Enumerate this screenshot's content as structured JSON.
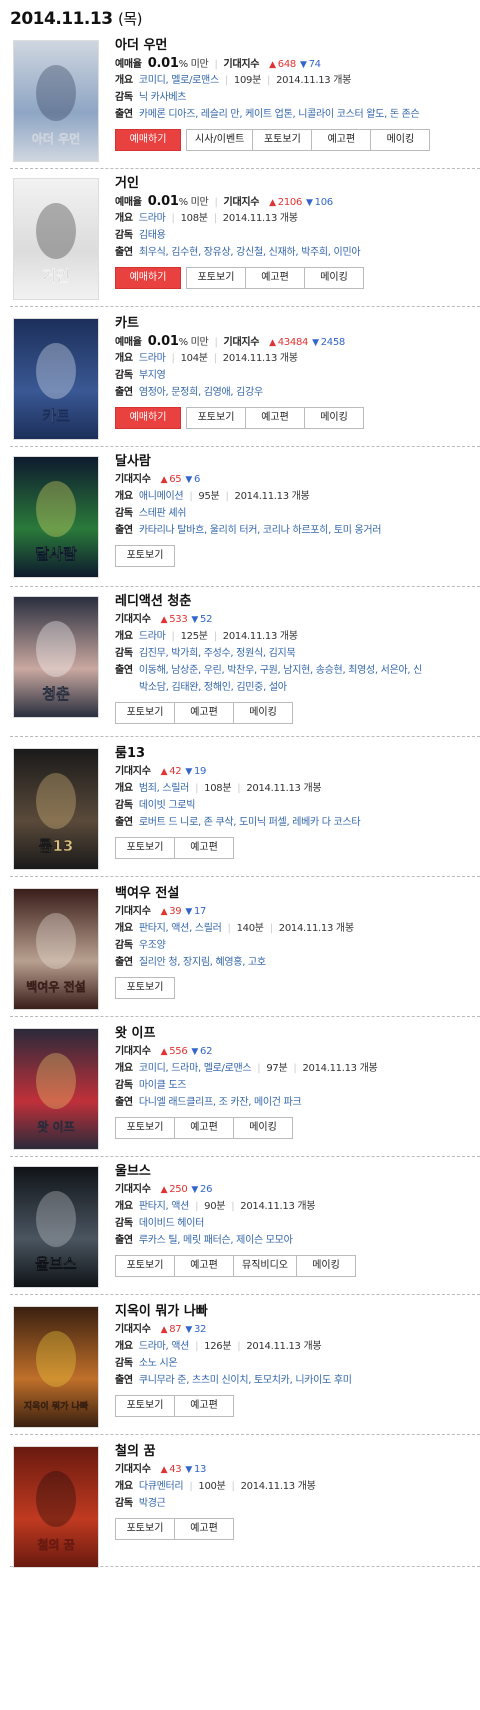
{
  "header": {
    "date": "2014.11.13",
    "dow": "(목)"
  },
  "labels": {
    "sales": "예매율",
    "expect": "기대지수",
    "overview": "개요",
    "director": "감독",
    "cast": "출연"
  },
  "movies": [
    {
      "title": "아더 우먼",
      "sales": "0.01",
      "sales_unit": "% 미만",
      "up": "648",
      "down": "74",
      "genre": "코미디, 멜로/로맨스",
      "runtime": "109분",
      "release": "2014.11.13 개봉",
      "director": "닉 카사베츠",
      "cast": "카메론 디아즈, 레슬리 만, 케이트 업톤, 니콜라이 코스터 왈도, 돈 존슨",
      "buttons": [
        "예매하기",
        "시사/이벤트",
        "포토보기",
        "예고편",
        "메이킹"
      ],
      "poster_text": "아더 우먼",
      "colors": [
        "#cfd6e0",
        "#8ea5c4",
        "#2b3a55"
      ]
    },
    {
      "title": "거인",
      "sales": "0.01",
      "sales_unit": "% 미만",
      "up": "2106",
      "down": "106",
      "genre": "드라마",
      "runtime": "108분",
      "release": "2014.11.13 개봉",
      "director": "김태용",
      "cast": "최우식, 김수현, 장유상, 강신철, 신재하, 박주희, 이민아",
      "buttons": [
        "예매하기",
        "포토보기",
        "예고편",
        "메이킹"
      ],
      "poster_text": "거인",
      "colors": [
        "#f2f2f2",
        "#dcdcdc",
        "#333333"
      ]
    },
    {
      "title": "카트",
      "sales": "0.01",
      "sales_unit": "% 미만",
      "up": "43484",
      "down": "2458",
      "genre": "드라마",
      "runtime": "104분",
      "release": "2014.11.13 개봉",
      "director": "부지영",
      "cast": "염정아, 문정희, 김영애, 김강우",
      "buttons": [
        "예매하기",
        "포토보기",
        "예고편",
        "메이킹"
      ],
      "poster_text": "카트",
      "colors": [
        "#1c2f5a",
        "#3a5894",
        "#e9eef6"
      ]
    },
    {
      "title": "달사람",
      "up": "65",
      "down": "6",
      "genre": "애니메이션",
      "runtime": "95분",
      "release": "2014.11.13 개봉",
      "director": "스테판 셰쉬",
      "cast": "카타리나 탈바흐, 울리히 터커, 코리나 하르포히, 토미 옹거러",
      "buttons": [
        "포토보기"
      ],
      "poster_text": "달사람",
      "colors": [
        "#0e1a2e",
        "#2a7a3a",
        "#e8e36a"
      ]
    },
    {
      "title": "레디액션 청춘",
      "up": "533",
      "down": "52",
      "genre": "드라마",
      "runtime": "125분",
      "release": "2014.11.13 개봉",
      "director": "김진무, 박가희, 주성수, 정원식, 김지묵",
      "cast": "이동해, 남상준, 우린, 박찬우, 구원, 남지현, 송승현, 최영성, 서은아, 신",
      "cast2": "박소담, 김태완, 정해인, 김민중, 설아",
      "buttons": [
        "포토보기",
        "예고편",
        "메이킹"
      ],
      "poster_text": "청춘",
      "colors": [
        "#2a2f3f",
        "#c9a8a0",
        "#ffffff"
      ]
    },
    {
      "title": "룸13",
      "up": "42",
      "down": "19",
      "genre": "범죄, 스릴러",
      "runtime": "108분",
      "release": "2014.11.13 개봉",
      "director": "데이빗 그로빅",
      "cast": "로버트 드 니로, 존 쿠삭, 도미닉 퍼셀, 레베카 다 코스타",
      "buttons": [
        "포토보기",
        "예고편"
      ],
      "poster_text": "룸13",
      "colors": [
        "#1a1a1a",
        "#5a4a3a",
        "#e0c080"
      ]
    },
    {
      "title": "백여우 전설",
      "up": "39",
      "down": "17",
      "genre": "판타지, 액션, 스릴러",
      "runtime": "140분",
      "release": "2014.11.13 개봉",
      "director": "우조양",
      "cast": "질리안 청, 장지림, 혜영홍, 고호",
      "buttons": [
        "포토보기"
      ],
      "poster_text": "백여우 전설",
      "colors": [
        "#3a1e1a",
        "#b8a090",
        "#f0e8e0"
      ]
    },
    {
      "title": "왓 이프",
      "up": "556",
      "down": "62",
      "genre": "코미디, 드라마, 멜로/로맨스",
      "runtime": "97분",
      "release": "2014.11.13 개봉",
      "director": "마이클 도즈",
      "cast": "다니엘 래드클리프, 조 카잔, 메이건 파크",
      "buttons": [
        "포토보기",
        "예고편",
        "메이킹"
      ],
      "poster_text": "왓 이프",
      "colors": [
        "#2b2a3a",
        "#c0303a",
        "#f0d070"
      ]
    },
    {
      "title": "울브스",
      "up": "250",
      "down": "26",
      "genre": "판타지, 액션",
      "runtime": "90분",
      "release": "2014.11.13 개봉",
      "director": "데이비드 헤이터",
      "cast": "루카스 틸, 메릿 패터슨, 제이슨 모모아",
      "buttons": [
        "포토보기",
        "예고편",
        "뮤직비디오",
        "메이킹"
      ],
      "poster_text": "울브스",
      "colors": [
        "#101418",
        "#4a5560",
        "#c8ccd0"
      ]
    },
    {
      "title": "지옥이 뭐가 나빠",
      "up": "87",
      "down": "32",
      "genre": "드라마, 액션",
      "runtime": "126분",
      "release": "2014.11.13 개봉",
      "director": "소노 시온",
      "cast": "쿠니무라 준, 츠츠미 신이치, 토모치카, 니카이도 후미",
      "buttons": [
        "포토보기",
        "예고편"
      ],
      "poster_text": "지옥이 뭐가 나빠",
      "colors": [
        "#3a2010",
        "#c0702a",
        "#f0d040"
      ]
    },
    {
      "title": "철의 꿈",
      "up": "43",
      "down": "13",
      "genre": "다큐멘터리",
      "runtime": "100분",
      "release": "2014.11.13 개봉",
      "director": "박경근",
      "buttons": [
        "포토보기",
        "예고편"
      ],
      "poster_text": "철의 꿈",
      "colors": [
        "#6a1a10",
        "#c03a20",
        "#1a0a08"
      ]
    }
  ]
}
